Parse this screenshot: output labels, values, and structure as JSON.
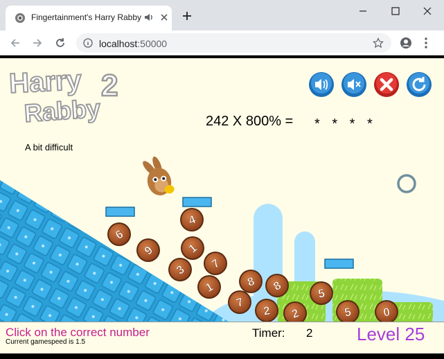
{
  "browser": {
    "tab_title": "Fingertainment's Harry Rabby",
    "url_host": "localhost",
    "url_port": ":50000"
  },
  "game": {
    "logo_line1": "Harry",
    "logo_line2": "Rabby",
    "logo_number": "2",
    "question": "242 X 800% =",
    "answer_mask": "* * * *",
    "difficulty": "A bit difficult",
    "controls": {
      "sound_on_icon": "speaker-icon",
      "mute_icon": "mute-icon",
      "close_icon": "close-x-icon",
      "restart_icon": "refresh-icon"
    },
    "number_balls": [
      {
        "digit": "6"
      },
      {
        "digit": "9"
      },
      {
        "digit": "4"
      },
      {
        "digit": "1"
      },
      {
        "digit": "3"
      },
      {
        "digit": "7"
      },
      {
        "digit": "1"
      },
      {
        "digit": "8"
      },
      {
        "digit": "8"
      },
      {
        "digit": "7"
      },
      {
        "digit": "2"
      },
      {
        "digit": "2"
      },
      {
        "digit": "5"
      },
      {
        "digit": "5"
      },
      {
        "digit": "0"
      }
    ],
    "colors": {
      "background": "#fffde8",
      "ball": "#b5582b",
      "ramp": "#2a9fd8",
      "grass": "#8ed53a",
      "platform": "#49b6ef"
    }
  },
  "status": {
    "instruction": "Click on the correct number",
    "gamespeed": "Current gamespeed is 1.5",
    "timer_label": "Timer:",
    "timer_value": "2",
    "level": "Level 25"
  }
}
